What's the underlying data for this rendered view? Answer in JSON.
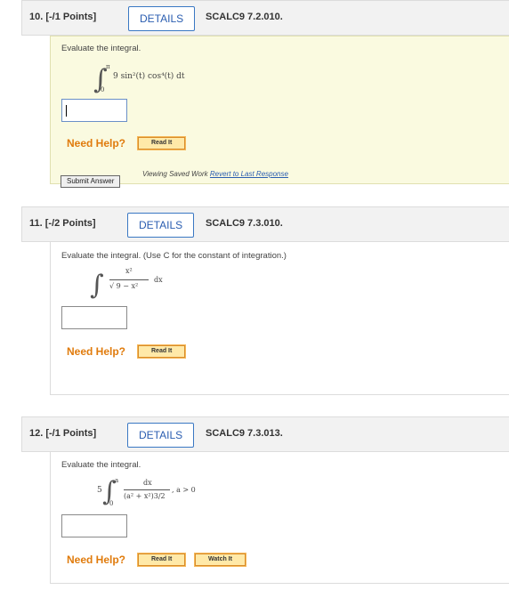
{
  "questions": [
    {
      "number": "10.  [-/1 Points]",
      "details_label": "DETAILS",
      "code": "SCALC9 7.2.010.",
      "prompt": "Evaluate the integral.",
      "integral": {
        "upper": "π",
        "lower": "0",
        "integrand": "9 sin²(t) cos⁴(t) dt"
      },
      "need_help": "Need Help?",
      "help_buttons": [
        "Read It"
      ],
      "submit_label": "Submit Answer",
      "saved_note": "Viewing Saved Work",
      "revert_link": "Revert to Last Response"
    },
    {
      "number": "11.  [-/2 Points]",
      "details_label": "DETAILS",
      "code": "SCALC9 7.3.010.",
      "prompt": "Evaluate the integral. (Use C for the constant of integration.)",
      "integral": {
        "numerator": "x²",
        "denominator": "√ 9 − x²",
        "differential": "dx"
      },
      "need_help": "Need Help?",
      "help_buttons": [
        "Read It"
      ]
    },
    {
      "number": "12.  [-/1 Points]",
      "details_label": "DETAILS",
      "code": "SCALC9 7.3.013.",
      "prompt": "Evaluate the integral.",
      "integral": {
        "coefficient": "5",
        "upper": "a",
        "lower": "0",
        "numerator": "dx",
        "denominator": "(a² + x²)3/2",
        "condition": ",    a > 0"
      },
      "need_help": "Need Help?",
      "help_buttons": [
        "Read It",
        "Watch It"
      ]
    }
  ]
}
